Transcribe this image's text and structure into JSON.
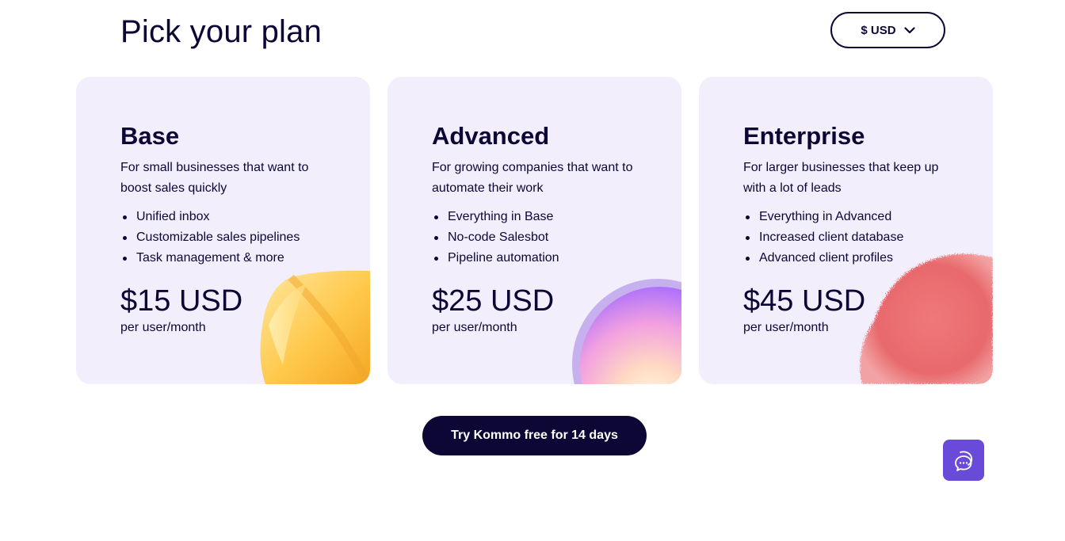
{
  "header": {
    "title": "Pick your plan",
    "currency": {
      "label": "$ USD",
      "icon": "chevron-down-icon"
    }
  },
  "plans": [
    {
      "name": "Base",
      "description": "For small businesses that want to boost sales quickly",
      "features": [
        "Unified inbox",
        "Customizable sales pipelines",
        "Task management & more"
      ],
      "price": "$15 USD",
      "period": "per user/month",
      "decoration": "yellow-pillow-illustration"
    },
    {
      "name": "Advanced",
      "description": "For growing companies that want to automate their work",
      "features": [
        "Everything in Base",
        "No-code Salesbot",
        "Pipeline automation"
      ],
      "price": "$25 USD",
      "period": "per user/month",
      "decoration": "glossy-sphere-illustration"
    },
    {
      "name": "Enterprise",
      "description": "For larger businesses that keep up with a lot of leads",
      "features": [
        "Everything in Advanced",
        "Increased client database",
        "Advanced client profiles"
      ],
      "price": "$45 USD",
      "period": "per user/month",
      "decoration": "pink-fluff-illustration"
    }
  ],
  "cta": {
    "label": "Try Kommo free for 14 days"
  },
  "chat": {
    "icon": "chat-bubbles-icon"
  },
  "colors": {
    "text": "#0c0735",
    "card_background": "#f2eefc",
    "cta_background": "#0c0735",
    "chat_widget": "#6a4ad8"
  }
}
